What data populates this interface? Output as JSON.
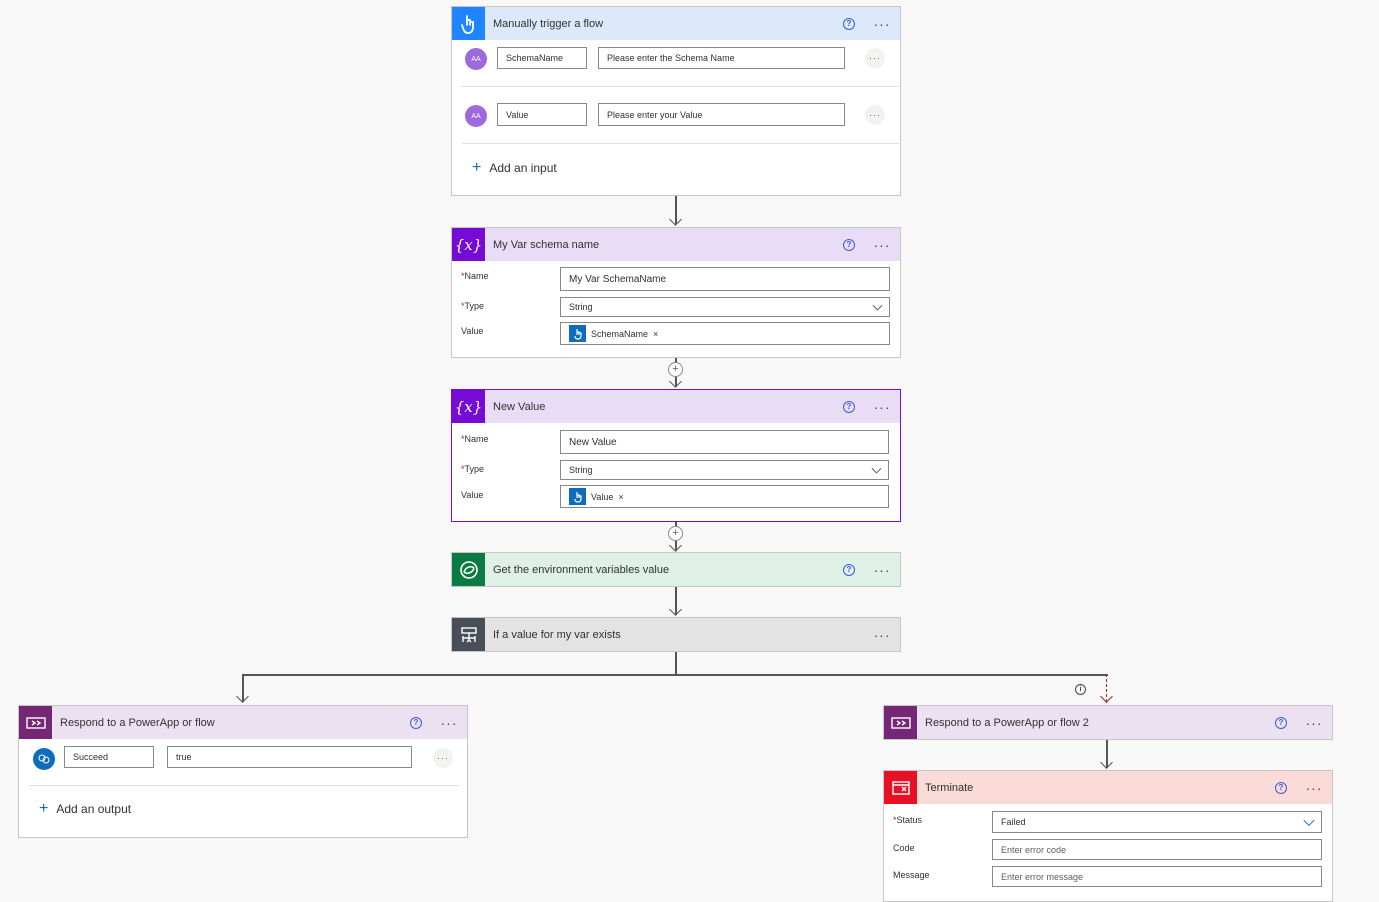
{
  "trigger": {
    "title": "Manually trigger a flow",
    "inputs": [
      {
        "name": "SchemaName",
        "placeholder": "Please enter the Schema Name"
      },
      {
        "name": "Value",
        "placeholder": "Please enter your Value"
      }
    ],
    "add_input_label": "Add an input"
  },
  "var1": {
    "title": "My Var schema name",
    "name_label": "Name",
    "name_value": "My Var SchemaName",
    "type_label": "Type",
    "type_value": "String",
    "value_label": "Value",
    "token": "SchemaName"
  },
  "var2": {
    "title": "New Value",
    "name_label": "Name",
    "name_value": "New Value",
    "type_label": "Type",
    "type_value": "String",
    "value_label": "Value",
    "token": "Value"
  },
  "env": {
    "title": "Get the environment variables value"
  },
  "condition": {
    "title": "If a value for my var exists"
  },
  "respond1": {
    "title": "Respond to a PowerApp or flow",
    "output_name": "Succeed",
    "output_value": "true",
    "add_output_label": "Add an output"
  },
  "respond2": {
    "title": "Respond to a PowerApp or flow 2"
  },
  "terminate": {
    "title": "Terminate",
    "status_label": "Status",
    "status_value": "Failed",
    "code_label": "Code",
    "code_placeholder": "Enter error code",
    "message_label": "Message",
    "message_placeholder": "Enter error message"
  },
  "common": {
    "help_glyph": "?",
    "more_glyph": "···",
    "required_mark": "*",
    "info_glyph": "i",
    "remove_glyph": "×",
    "avatar_text": "AA"
  },
  "colors": {
    "trigger_header": "#dbe9fb",
    "trigger_icon": "#1f85ff",
    "variable_header": "#e9dcf6",
    "variable_icon": "#770bd6",
    "dataverse_header": "#dff0e6",
    "dataverse_icon": "#0c7a43",
    "condition_header": "#e3e3e3",
    "condition_icon": "#484f58",
    "powerapps_header": "#ece1f0",
    "powerapps_icon": "#742774",
    "terminate_header": "#fadbd8",
    "terminate_icon": "#e81123"
  }
}
